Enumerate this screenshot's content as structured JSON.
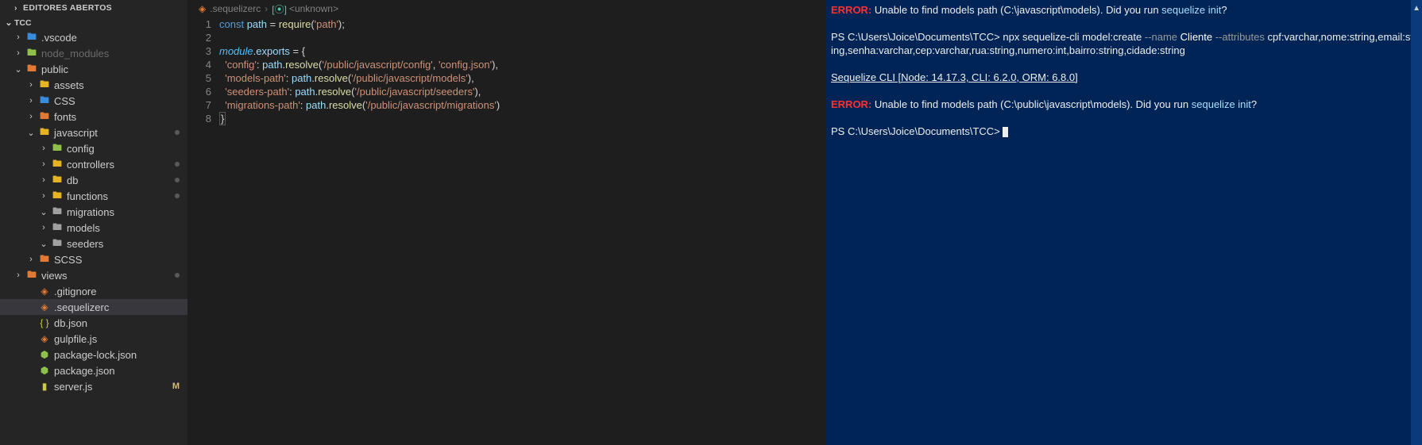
{
  "sidebar": {
    "section_header": "Editores Abertos",
    "project": "TCC",
    "items": [
      {
        "ind": 16,
        "chev": "right",
        "icon": "folder-blue",
        "glyph": "🖿",
        "label": ".vscode"
      },
      {
        "ind": 16,
        "chev": "right",
        "icon": "folder-green",
        "glyph": "🖿",
        "label": "node_modules",
        "dim": true
      },
      {
        "ind": 16,
        "chev": "down",
        "icon": "folder-orange",
        "glyph": "🖿",
        "label": "public"
      },
      {
        "ind": 32,
        "chev": "right",
        "icon": "folder-yell",
        "glyph": "🖿",
        "label": "assets"
      },
      {
        "ind": 32,
        "chev": "right",
        "icon": "folder-blue",
        "glyph": "🖿",
        "label": "CSS"
      },
      {
        "ind": 32,
        "chev": "right",
        "icon": "folder-orange",
        "glyph": "🖿",
        "label": "fonts"
      },
      {
        "ind": 32,
        "chev": "down",
        "icon": "folder-yell",
        "glyph": "🖿",
        "label": "javascript",
        "dot": true
      },
      {
        "ind": 48,
        "chev": "right",
        "icon": "folder-green",
        "glyph": "🖿",
        "label": "config"
      },
      {
        "ind": 48,
        "chev": "right",
        "icon": "folder-yell",
        "glyph": "🖿",
        "label": "controllers",
        "dot": true
      },
      {
        "ind": 48,
        "chev": "right",
        "icon": "folder-yell",
        "glyph": "🖿",
        "label": "db",
        "dot": true
      },
      {
        "ind": 48,
        "chev": "right",
        "icon": "folder-yell",
        "glyph": "🖿",
        "label": "functions",
        "dot": true
      },
      {
        "ind": 48,
        "chev": "down",
        "icon": "folder-grey",
        "glyph": "🖿",
        "label": "migrations"
      },
      {
        "ind": 48,
        "chev": "right",
        "icon": "folder-grey",
        "glyph": "🖿",
        "label": "models"
      },
      {
        "ind": 48,
        "chev": "down",
        "icon": "folder-grey",
        "glyph": "🖿",
        "label": "seeders"
      },
      {
        "ind": 32,
        "chev": "right",
        "icon": "folder-orange",
        "glyph": "🖿",
        "label": "SCSS"
      },
      {
        "ind": 16,
        "chev": "right",
        "icon": "folder-orange",
        "glyph": "🖿",
        "label": "views",
        "dot": true
      },
      {
        "ind": 32,
        "chev": "",
        "icon": "file-orange",
        "glyph": "◈",
        "label": ".gitignore"
      },
      {
        "ind": 32,
        "chev": "",
        "icon": "file-orange",
        "glyph": "◈",
        "label": ".sequelizerc",
        "active": true
      },
      {
        "ind": 32,
        "chev": "",
        "icon": "file-yell",
        "glyph": "{ }",
        "label": "db.json"
      },
      {
        "ind": 32,
        "chev": "",
        "icon": "file-orange",
        "glyph": "◈",
        "label": "gulpfile.js"
      },
      {
        "ind": 32,
        "chev": "",
        "icon": "file-green",
        "glyph": "⬢",
        "label": "package-lock.json"
      },
      {
        "ind": 32,
        "chev": "",
        "icon": "file-green",
        "glyph": "⬢",
        "label": "package.json"
      },
      {
        "ind": 32,
        "chev": "",
        "icon": "file-yell",
        "glyph": "▮",
        "label": "server.js",
        "badge": "M"
      }
    ]
  },
  "breadcrumb": {
    "file": ".sequelizerc",
    "symbol": "<unknown>"
  },
  "code": {
    "line_count": 8,
    "lines": [
      {
        "raw": "const path = require('path');"
      },
      {
        "raw": ""
      },
      {
        "raw": "module.exports = {"
      },
      {
        "raw": "  'config': path.resolve('/public/javascript/config', 'config.json'),"
      },
      {
        "raw": "  'models-path': path.resolve('/public/javascript/models'),"
      },
      {
        "raw": "  'seeders-path': path.resolve('/public/javascript/seeders'),"
      },
      {
        "raw": "  'migrations-path': path.resolve('/public/javascript/migrations')"
      },
      {
        "raw": "}"
      }
    ]
  },
  "terminal": {
    "lines": [
      {
        "type": "err",
        "error_label": "ERROR:",
        "text": " Unable to find models path (C:\\javascript\\models). Did you run ",
        "cmd": "sequelize init",
        "tail": "?"
      },
      {
        "type": "blank"
      },
      {
        "type": "prompt",
        "prompt": "PS C:\\Users\\Joice\\Documents\\TCC> ",
        "cmd": "npx sequelize-cli model:create ",
        "flag": "--name ",
        "argname": "Cliente ",
        "flag2": "--attributes ",
        "args": "cpf:varchar,nome:string,email:string,senha:varchar,cep:varchar,rua:string,numero:int,bairro:string,cidade:string"
      },
      {
        "type": "blank"
      },
      {
        "type": "underline",
        "text": "Sequelize CLI [Node: 14.17.3, CLI: 6.2.0, ORM: 6.8.0]"
      },
      {
        "type": "blank"
      },
      {
        "type": "err",
        "error_label": "ERROR:",
        "text": " Unable to find models path (C:\\public\\javascript\\models). Did you run ",
        "cmd": "sequelize init",
        "tail": "?"
      },
      {
        "type": "blank"
      },
      {
        "type": "cursor",
        "prompt": "PS C:\\Users\\Joice\\Documents\\TCC> "
      }
    ]
  }
}
